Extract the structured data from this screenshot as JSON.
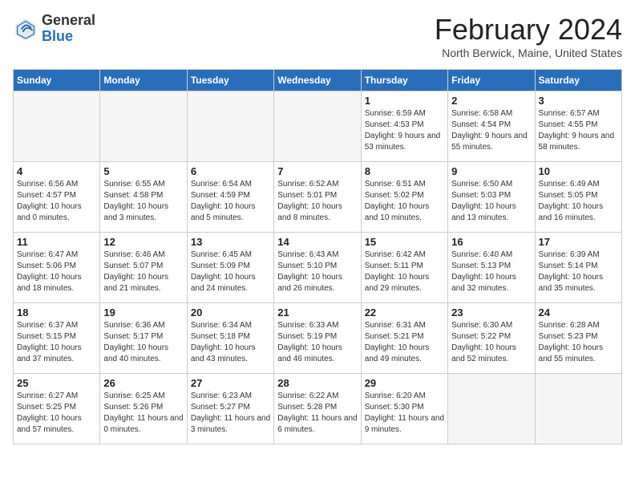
{
  "app": {
    "name_general": "General",
    "name_blue": "Blue"
  },
  "header": {
    "title": "February 2024",
    "subtitle": "North Berwick, Maine, United States"
  },
  "days_of_week": [
    "Sunday",
    "Monday",
    "Tuesday",
    "Wednesday",
    "Thursday",
    "Friday",
    "Saturday"
  ],
  "weeks": [
    [
      {
        "day": "",
        "info": ""
      },
      {
        "day": "",
        "info": ""
      },
      {
        "day": "",
        "info": ""
      },
      {
        "day": "",
        "info": ""
      },
      {
        "day": "1",
        "info": "Sunrise: 6:59 AM\nSunset: 4:53 PM\nDaylight: 9 hours\nand 53 minutes."
      },
      {
        "day": "2",
        "info": "Sunrise: 6:58 AM\nSunset: 4:54 PM\nDaylight: 9 hours\nand 55 minutes."
      },
      {
        "day": "3",
        "info": "Sunrise: 6:57 AM\nSunset: 4:55 PM\nDaylight: 9 hours\nand 58 minutes."
      }
    ],
    [
      {
        "day": "4",
        "info": "Sunrise: 6:56 AM\nSunset: 4:57 PM\nDaylight: 10 hours\nand 0 minutes."
      },
      {
        "day": "5",
        "info": "Sunrise: 6:55 AM\nSunset: 4:58 PM\nDaylight: 10 hours\nand 3 minutes."
      },
      {
        "day": "6",
        "info": "Sunrise: 6:54 AM\nSunset: 4:59 PM\nDaylight: 10 hours\nand 5 minutes."
      },
      {
        "day": "7",
        "info": "Sunrise: 6:52 AM\nSunset: 5:01 PM\nDaylight: 10 hours\nand 8 minutes."
      },
      {
        "day": "8",
        "info": "Sunrise: 6:51 AM\nSunset: 5:02 PM\nDaylight: 10 hours\nand 10 minutes."
      },
      {
        "day": "9",
        "info": "Sunrise: 6:50 AM\nSunset: 5:03 PM\nDaylight: 10 hours\nand 13 minutes."
      },
      {
        "day": "10",
        "info": "Sunrise: 6:49 AM\nSunset: 5:05 PM\nDaylight: 10 hours\nand 16 minutes."
      }
    ],
    [
      {
        "day": "11",
        "info": "Sunrise: 6:47 AM\nSunset: 5:06 PM\nDaylight: 10 hours\nand 18 minutes."
      },
      {
        "day": "12",
        "info": "Sunrise: 6:46 AM\nSunset: 5:07 PM\nDaylight: 10 hours\nand 21 minutes."
      },
      {
        "day": "13",
        "info": "Sunrise: 6:45 AM\nSunset: 5:09 PM\nDaylight: 10 hours\nand 24 minutes."
      },
      {
        "day": "14",
        "info": "Sunrise: 6:43 AM\nSunset: 5:10 PM\nDaylight: 10 hours\nand 26 minutes."
      },
      {
        "day": "15",
        "info": "Sunrise: 6:42 AM\nSunset: 5:11 PM\nDaylight: 10 hours\nand 29 minutes."
      },
      {
        "day": "16",
        "info": "Sunrise: 6:40 AM\nSunset: 5:13 PM\nDaylight: 10 hours\nand 32 minutes."
      },
      {
        "day": "17",
        "info": "Sunrise: 6:39 AM\nSunset: 5:14 PM\nDaylight: 10 hours\nand 35 minutes."
      }
    ],
    [
      {
        "day": "18",
        "info": "Sunrise: 6:37 AM\nSunset: 5:15 PM\nDaylight: 10 hours\nand 37 minutes."
      },
      {
        "day": "19",
        "info": "Sunrise: 6:36 AM\nSunset: 5:17 PM\nDaylight: 10 hours\nand 40 minutes."
      },
      {
        "day": "20",
        "info": "Sunrise: 6:34 AM\nSunset: 5:18 PM\nDaylight: 10 hours\nand 43 minutes."
      },
      {
        "day": "21",
        "info": "Sunrise: 6:33 AM\nSunset: 5:19 PM\nDaylight: 10 hours\nand 46 minutes."
      },
      {
        "day": "22",
        "info": "Sunrise: 6:31 AM\nSunset: 5:21 PM\nDaylight: 10 hours\nand 49 minutes."
      },
      {
        "day": "23",
        "info": "Sunrise: 6:30 AM\nSunset: 5:22 PM\nDaylight: 10 hours\nand 52 minutes."
      },
      {
        "day": "24",
        "info": "Sunrise: 6:28 AM\nSunset: 5:23 PM\nDaylight: 10 hours\nand 55 minutes."
      }
    ],
    [
      {
        "day": "25",
        "info": "Sunrise: 6:27 AM\nSunset: 5:25 PM\nDaylight: 10 hours\nand 57 minutes."
      },
      {
        "day": "26",
        "info": "Sunrise: 6:25 AM\nSunset: 5:26 PM\nDaylight: 11 hours\nand 0 minutes."
      },
      {
        "day": "27",
        "info": "Sunrise: 6:23 AM\nSunset: 5:27 PM\nDaylight: 11 hours\nand 3 minutes."
      },
      {
        "day": "28",
        "info": "Sunrise: 6:22 AM\nSunset: 5:28 PM\nDaylight: 11 hours\nand 6 minutes."
      },
      {
        "day": "29",
        "info": "Sunrise: 6:20 AM\nSunset: 5:30 PM\nDaylight: 11 hours\nand 9 minutes."
      },
      {
        "day": "",
        "info": ""
      },
      {
        "day": "",
        "info": ""
      }
    ]
  ]
}
